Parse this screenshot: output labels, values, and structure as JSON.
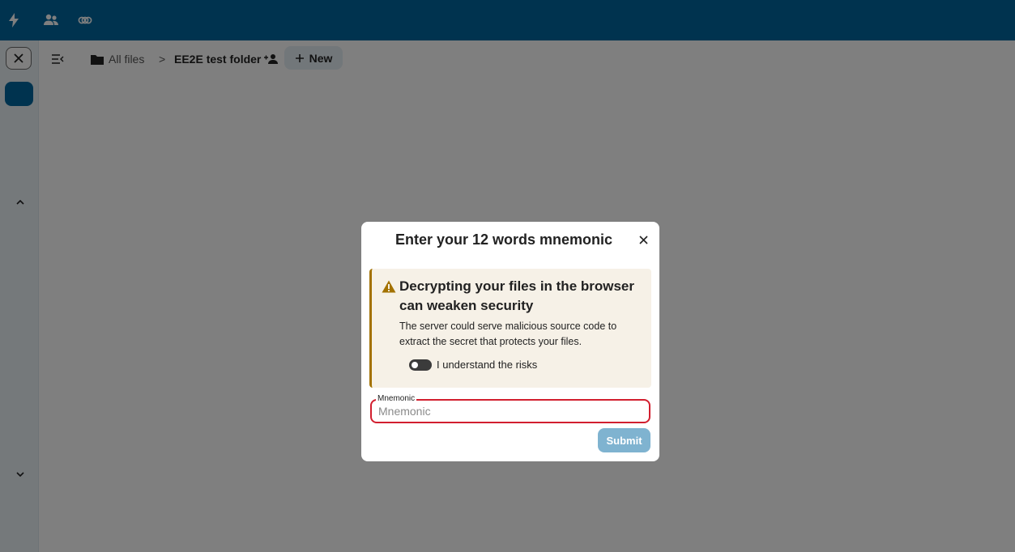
{
  "header": {
    "icons": [
      "activity-icon",
      "contacts-icon",
      "circles-icon"
    ]
  },
  "nav": {
    "close_label": "×"
  },
  "breadcrumb": {
    "root": "All files",
    "separator": ">",
    "current": "EE2E test folder"
  },
  "toolbar": {
    "new_label": "New"
  },
  "modal": {
    "title": "Enter your 12 words mnemonic",
    "close_label": "×",
    "warning": {
      "title": "Decrypting your files in the browser can weaken security",
      "body": "The server could serve malicious source code to extract the secret that protects your files.",
      "toggle_label": "I understand the risks",
      "toggle_on": false,
      "accent": "#a37200"
    },
    "field": {
      "legend": "Mnemonic",
      "placeholder": "Mnemonic",
      "value": "",
      "error_color": "#d21f2f"
    },
    "submit_label": "Submit"
  },
  "colors": {
    "primary": "#00679e",
    "submit_disabled": "#7fb3d0"
  }
}
